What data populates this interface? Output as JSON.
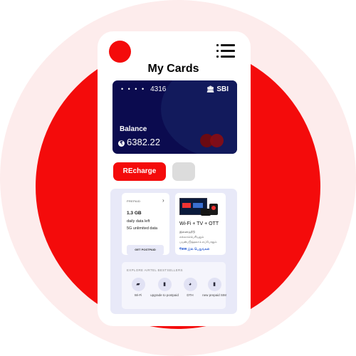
{
  "header": {
    "title": "My Cards"
  },
  "card": {
    "masked_dots": "• • • •",
    "last_digits": "4316",
    "bank_icon": "bank-icon",
    "bank": "SBI",
    "balance_label": "Balance",
    "currency_symbol": "₹",
    "balance": "6382.22"
  },
  "actions": {
    "recharge_label": "REcharge"
  },
  "prepaid": {
    "label": "PREPAID",
    "chevron": "›",
    "data": "1.3 GB",
    "line1": "daily data left",
    "line2": "5G unlimited data",
    "button": "GET POSTPAID"
  },
  "ott": {
    "heading": "Wi-Fi + TV + OTT",
    "tamil1": "இணைத்திடு",
    "tamil2": "எல்லாம்பெரியதும்",
    "tamil3": "பயன்படுத்தலாம் எப்போதும்",
    "price": "₹699 இல் பெறுங்கள்"
  },
  "bestsellers": {
    "heading": "EXPLORE AIRTEL BESTSELLERS",
    "items": [
      {
        "icon": "wifi-router-icon",
        "glyph": "▰",
        "label": "Wi-Fi"
      },
      {
        "icon": "sim-upgrade-icon",
        "glyph": "▮",
        "label": "upgrade to postpaid"
      },
      {
        "icon": "dth-dish-icon",
        "glyph": "◕",
        "label": "DTH"
      },
      {
        "icon": "prepaid-sim-icon",
        "glyph": "▮",
        "label": "new prepaid SIM"
      }
    ]
  },
  "colors": {
    "accent": "#f40b0b",
    "card_bg": "#0b0b4f",
    "panel_bg": "#e8e9f8"
  }
}
